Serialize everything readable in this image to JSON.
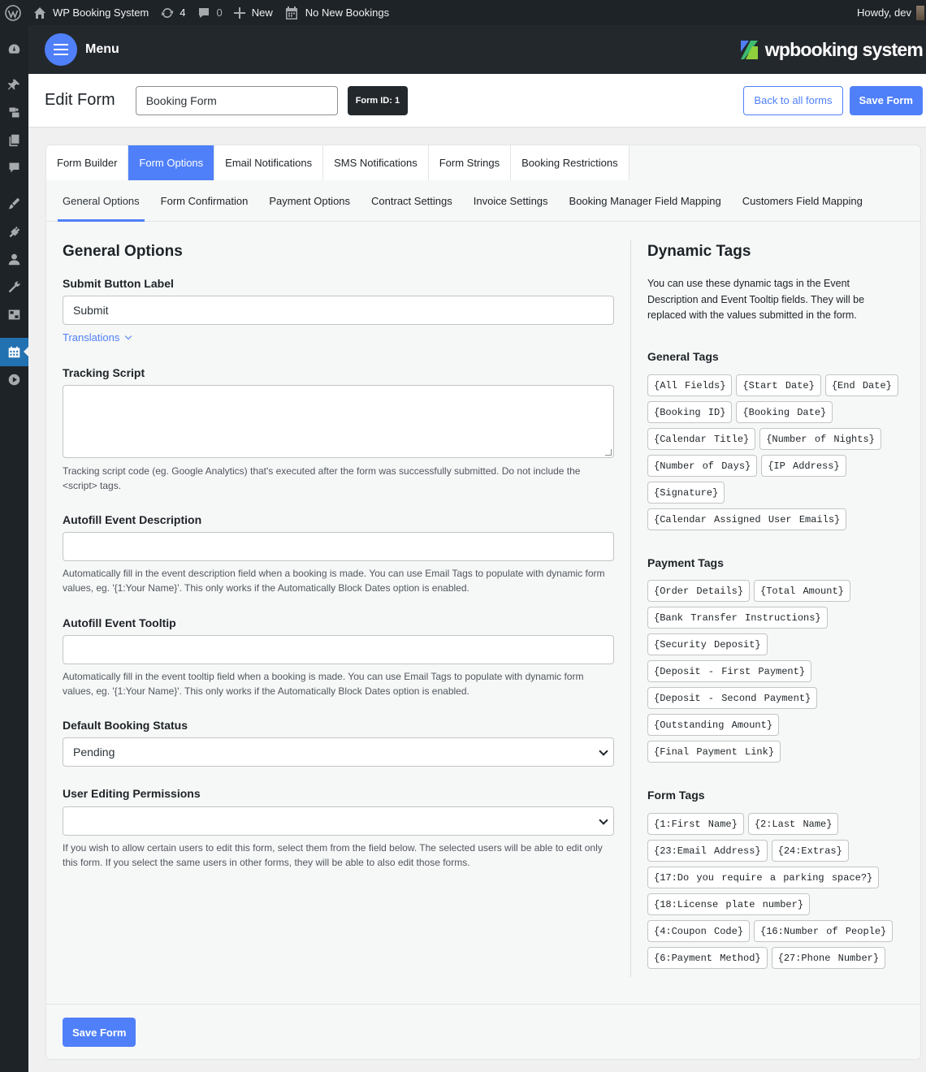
{
  "admin_bar": {
    "site_name": "WP Booking System",
    "updates_count": "4",
    "comments_count": "0",
    "new_label": "New",
    "bookings_label": "No New Bookings",
    "howdy": "Howdy, dev"
  },
  "topbar": {
    "menu_label": "Menu",
    "logo_text": "wpbooking system"
  },
  "header": {
    "title": "Edit Form",
    "form_name_value": "Booking Form",
    "form_id": "Form ID: 1",
    "back_label": "Back to all forms",
    "save_label": "Save Form"
  },
  "tabs": [
    "Form Builder",
    "Form Options",
    "Email Notifications",
    "SMS Notifications",
    "Form Strings",
    "Booking Restrictions"
  ],
  "subtabs": [
    "General Options",
    "Form Confirmation",
    "Payment Options",
    "Contract Settings",
    "Invoice Settings",
    "Booking Manager Field Mapping",
    "Customers Field Mapping"
  ],
  "general": {
    "title": "General Options",
    "submit_label": "Submit Button Label",
    "submit_value": "Submit",
    "translations": "Translations",
    "tracking_label": "Tracking Script",
    "tracking_help": "Tracking script code (eg. Google Analytics) that's executed after the form was successfully submitted. Do not include the <script> tags.",
    "desc_label": "Autofill Event Description",
    "desc_help": "Automatically fill in the event description field when a booking is made. You can use Email Tags to populate with dynamic form values, eg. '{1:Your Name}'. This only works if the Automatically Block Dates option is enabled.",
    "tooltip_label": "Autofill Event Tooltip",
    "tooltip_help": "Automatically fill in the event tooltip field when a booking is made. You can use Email Tags to populate with dynamic form values, eg. '{1:Your Name}'. This only works if the Automatically Block Dates option is enabled.",
    "status_label": "Default Booking Status",
    "status_value": "Pending",
    "perm_label": "User Editing Permissions",
    "perm_value": "",
    "perm_help": "If you wish to allow certain users to edit this form, select them from the field below. The selected users will be able to edit only this form. If you select the same users in other forms, they will be able to also edit those forms."
  },
  "dynamic": {
    "title": "Dynamic Tags",
    "desc": "You can use these dynamic tags in the Event Description and Event Tooltip fields. They will be replaced with the values submitted in the form.",
    "general_title": "General Tags",
    "general_tags": [
      "{All Fields}",
      "{Start Date}",
      "{End Date}",
      "{Booking ID}",
      "{Booking Date}",
      "{Calendar Title}",
      "{Number of Nights}",
      "{Number of Days}",
      "{IP Address}",
      "{Signature}",
      "{Calendar Assigned User Emails}"
    ],
    "payment_title": "Payment Tags",
    "payment_tags": [
      "{Order Details}",
      "{Total Amount}",
      "{Bank Transfer Instructions}",
      "{Security Deposit}",
      "{Deposit - First Payment}",
      "{Deposit - Second Payment}",
      "{Outstanding Amount}",
      "{Final Payment Link}"
    ],
    "form_title": "Form Tags",
    "form_tags": [
      "{1:First Name}",
      "{2:Last Name}",
      "{23:Email Address}",
      "{24:Extras}",
      "{17:Do you require a parking space?}",
      "{18:License plate number}",
      "{4:Coupon Code}",
      "{16:Number of People}",
      "{6:Payment Method}",
      "{27:Phone Number}"
    ]
  },
  "footer": {
    "save_label": "Save Form"
  },
  "colors": {
    "accent": "#4f80f9",
    "admin_dark": "#1d2327"
  }
}
